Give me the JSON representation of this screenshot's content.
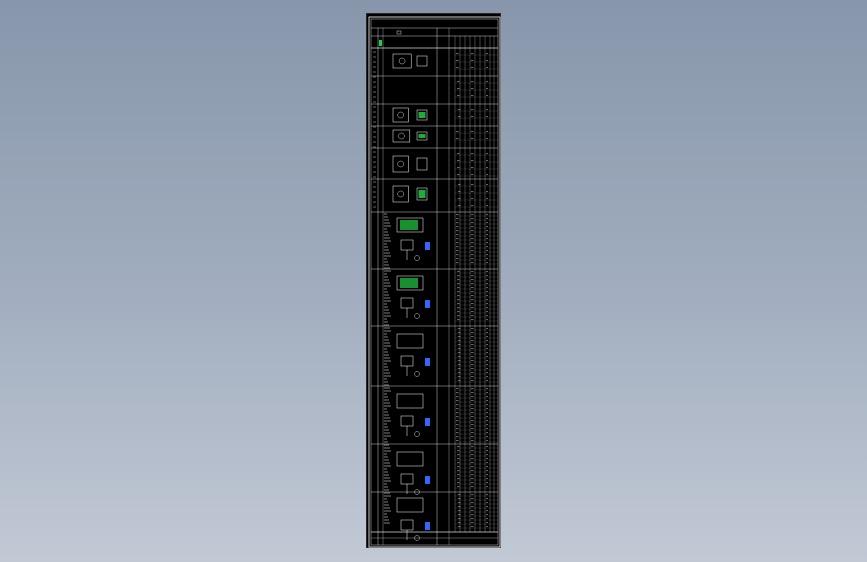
{
  "viewport": {
    "background_top": "#8796ab",
    "background_bottom": "#c2c9d5"
  },
  "drawing": {
    "sheet_color": "#000000",
    "line_color": "#ffffff",
    "highlight_color": "#22cc44",
    "accent_color": "#3366ff"
  }
}
